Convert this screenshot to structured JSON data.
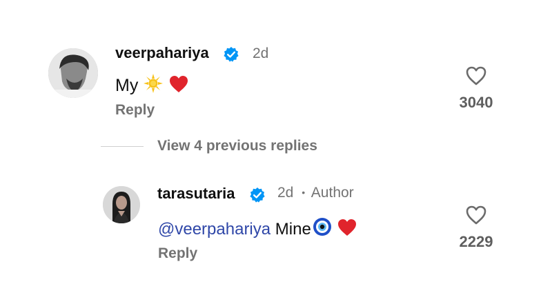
{
  "comment": {
    "username": "veerpahariya",
    "time": "2d",
    "text_prefix": "My",
    "reply_label": "Reply",
    "like_count": "3040",
    "emojis": [
      "sun-emoji",
      "red-heart-emoji"
    ]
  },
  "view_replies_label": "View 4 previous replies",
  "reply": {
    "username": "tarasutaria",
    "time": "2d",
    "separator": "•",
    "author_label": "Author",
    "mention": "@veerpahariya",
    "text_suffix": " Mine",
    "reply_label": "Reply",
    "like_count": "2229",
    "emojis": [
      "nazar-amulet-emoji",
      "red-heart-emoji"
    ]
  },
  "colors": {
    "verified_blue": "#0095f6",
    "mention_blue": "#2f47a8",
    "heart_red": "#e0242c",
    "muted_text": "#737373"
  }
}
